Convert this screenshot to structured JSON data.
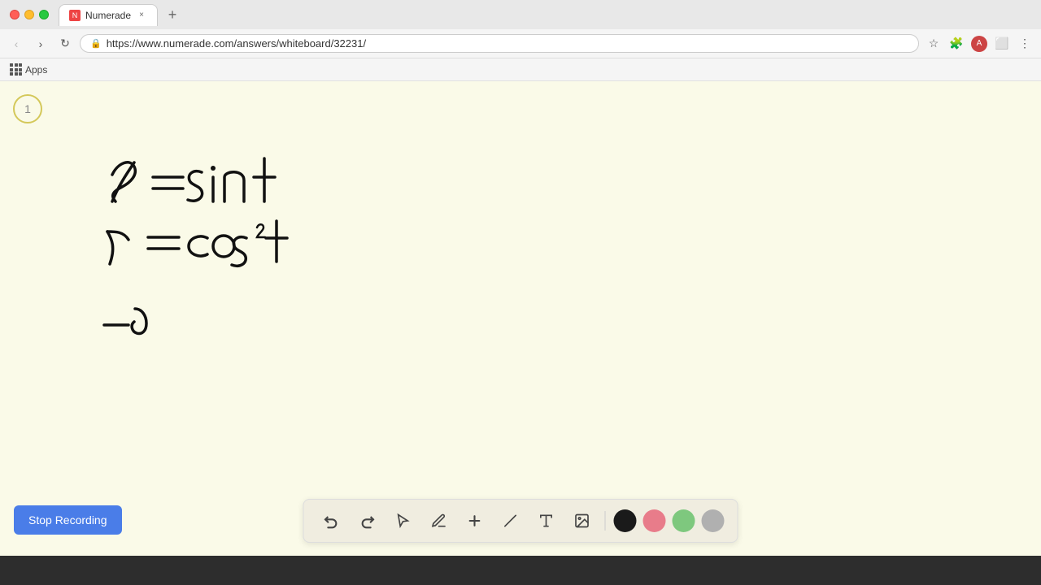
{
  "browser": {
    "traffic_lights": [
      "close",
      "minimize",
      "maximize"
    ],
    "tab": {
      "title": "Numerade",
      "favicon_text": "N",
      "close_label": "×"
    },
    "new_tab_label": "+",
    "address": "https://www.numerade.com/answers/whiteboard/32231/",
    "nav_back": "‹",
    "nav_forward": "›",
    "nav_refresh": "↻",
    "lock_icon": "🔒"
  },
  "bookmarks": {
    "apps_label": "Apps"
  },
  "slide_number": "1",
  "stop_recording_label": "Stop Recording",
  "toolbar": {
    "undo_icon": "↩",
    "redo_icon": "↪",
    "select_icon": "↖",
    "pen_icon": "✏",
    "add_icon": "+",
    "highlight_icon": "/",
    "text_icon": "A",
    "image_icon": "🖼",
    "colors": [
      {
        "name": "black",
        "hex": "#1a1a1a"
      },
      {
        "name": "pink",
        "hex": "#e87c8a"
      },
      {
        "name": "green",
        "hex": "#7ec87e"
      },
      {
        "name": "gray",
        "hex": "#b0b0b0"
      }
    ]
  }
}
